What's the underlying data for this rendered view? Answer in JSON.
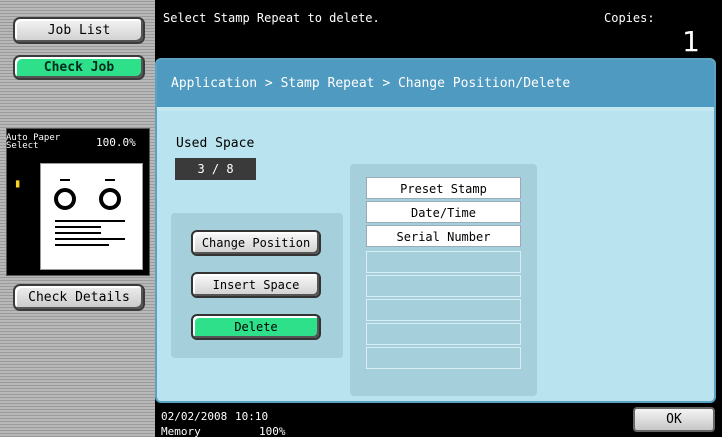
{
  "left_panel": {
    "job_list_label": "Job List",
    "check_job_label": "Check Job",
    "auto_paper_label": "Auto Paper Select",
    "zoom": "100.0%",
    "check_details_label": "Check Details"
  },
  "header": {
    "message": "Select Stamp Repeat to delete.",
    "copies_label": "Copies:",
    "copies_value": "1"
  },
  "main": {
    "breadcrumb": "Application > Stamp Repeat > Change Position/Delete",
    "used_space_label": "Used Space",
    "used_space_value": "3 / 8",
    "buttons": {
      "change_position": "Change Position",
      "insert_space": "Insert Space",
      "delete": "Delete"
    },
    "list": [
      "Preset Stamp",
      "Date/Time",
      "Serial Number"
    ]
  },
  "footer": {
    "date": "02/02/2008",
    "time": "10:10",
    "memory_label": "Memory",
    "memory_value": "100%",
    "ok_label": "OK"
  },
  "colors": {
    "accent_green": "#2ee08a",
    "panel_blue": "#b9e3ee",
    "breadcrumb_blue": "#4f9ac1"
  }
}
